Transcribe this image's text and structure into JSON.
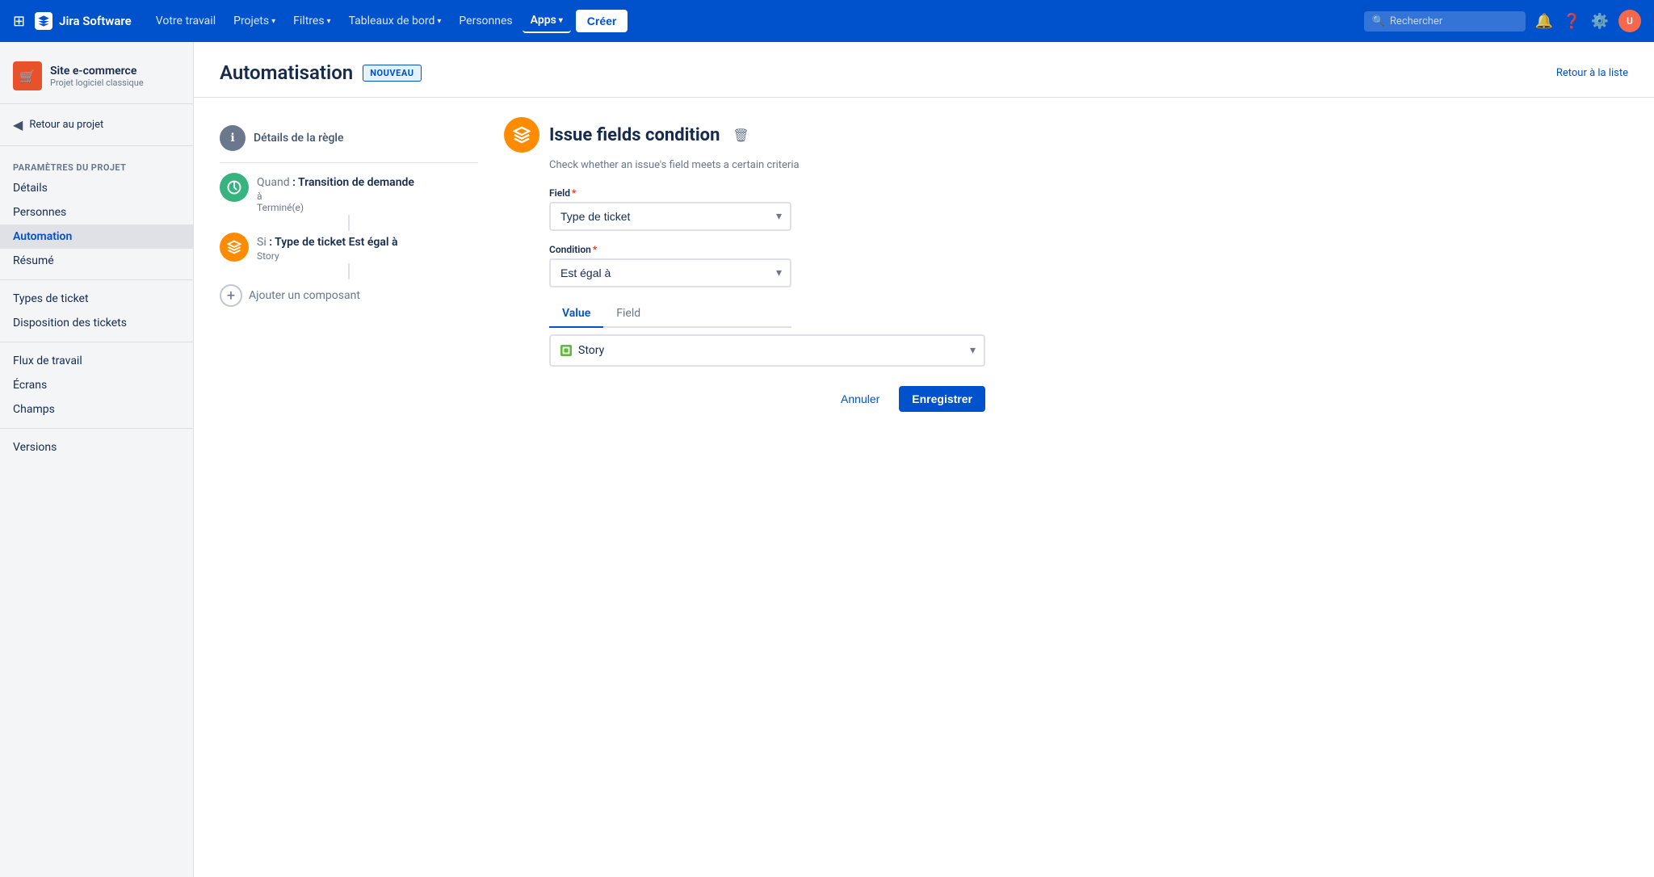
{
  "topnav": {
    "brand": "Jira Software",
    "links": [
      {
        "label": "Votre travail",
        "hasChevron": false,
        "active": false
      },
      {
        "label": "Projets",
        "hasChevron": true,
        "active": false
      },
      {
        "label": "Filtres",
        "hasChevron": true,
        "active": false
      },
      {
        "label": "Tableaux de bord",
        "hasChevron": true,
        "active": false
      },
      {
        "label": "Personnes",
        "hasChevron": false,
        "active": false
      },
      {
        "label": "Apps",
        "hasChevron": true,
        "active": true
      }
    ],
    "create_label": "Créer",
    "search_placeholder": "Rechercher",
    "back_to_list": "Retour à la liste"
  },
  "sidebar": {
    "project_name": "Site e-commerce",
    "project_sub": "Projet logiciel classique",
    "back_label": "Retour au projet",
    "section_label": "Paramètres du projet",
    "items": [
      {
        "label": "Détails",
        "active": false
      },
      {
        "label": "Personnes",
        "active": false
      },
      {
        "label": "Automation",
        "active": true
      },
      {
        "label": "Résumé",
        "active": false
      }
    ],
    "items2": [
      {
        "label": "Types de ticket",
        "active": false
      },
      {
        "label": "Disposition des tickets",
        "active": false
      }
    ],
    "items3": [
      {
        "label": "Flux de travail",
        "active": false
      },
      {
        "label": "Écrans",
        "active": false
      },
      {
        "label": "Champs",
        "active": false
      }
    ],
    "items4": [
      {
        "label": "Versions",
        "active": false
      }
    ]
  },
  "page": {
    "title": "Automatisation",
    "badge": "NOUVEAU",
    "rule_details": "Détails de la règle",
    "when_label": "Quand",
    "when_title": "Transition de demande",
    "when_sub1": "à",
    "when_sub2": "Terminé(e)",
    "if_label": "Si",
    "if_title": "Type de ticket Est égal à",
    "if_sub": "Story",
    "add_component": "Ajouter un composant"
  },
  "condition": {
    "title": "Issue fields condition",
    "description": "Check whether an issue's field meets a certain criteria",
    "field_label": "Field",
    "field_value": "Type de ticket",
    "condition_label": "Condition",
    "condition_value": "Est égal à",
    "tab_value": "Value",
    "tab_field": "Field",
    "story_label": "Story",
    "cancel_label": "Annuler",
    "save_label": "Enregistrer"
  }
}
